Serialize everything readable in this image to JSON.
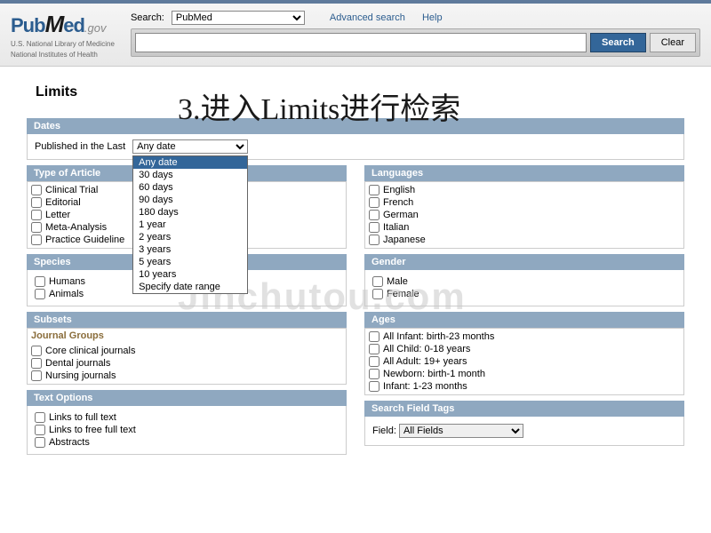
{
  "header": {
    "logo_text_pub": "Pub",
    "logo_text_m": "M",
    "logo_text_ed": "ed",
    "logo_gov": ".gov",
    "logo_sub1": "U.S. National Library of Medicine",
    "logo_sub2": "National Institutes of Health",
    "search_label": "Search:",
    "search_db_selected": "PubMed",
    "adv_search": "Advanced search",
    "help": "Help",
    "btn_search": "Search",
    "btn_clear": "Clear",
    "search_value": ""
  },
  "page_title": "Limits",
  "overlay": "3.进入Limits进行检索",
  "watermark": "Jinchutou.com",
  "dates": {
    "header": "Dates",
    "label": "Published in the Last",
    "selected": "Any date",
    "options": [
      "Any date",
      "30 days",
      "60 days",
      "90 days",
      "180 days",
      "1 year",
      "2 years",
      "3 years",
      "5 years",
      "10 years",
      "Specify date range"
    ]
  },
  "type_of_article": {
    "header": "Type of Article",
    "items": [
      "Clinical Trial",
      "Editorial",
      "Letter",
      "Meta-Analysis",
      "Practice Guideline"
    ]
  },
  "languages": {
    "header": "Languages",
    "items": [
      "English",
      "French",
      "German",
      "Italian",
      "Japanese"
    ]
  },
  "species": {
    "header": "Species",
    "items": [
      "Humans",
      "Animals"
    ]
  },
  "gender": {
    "header": "Gender",
    "items": [
      "Male",
      "Female"
    ]
  },
  "subsets": {
    "header": "Subsets",
    "subhead": "Journal Groups",
    "items": [
      "Core clinical journals",
      "Dental journals",
      "Nursing journals"
    ]
  },
  "ages": {
    "header": "Ages",
    "items": [
      "All Infant: birth-23 months",
      "All Child: 0-18 years",
      "All Adult: 19+ years",
      "Newborn: birth-1 month",
      "Infant: 1-23 months"
    ]
  },
  "text_options": {
    "header": "Text Options",
    "items": [
      "Links to full text",
      "Links to free full text",
      "Abstracts"
    ]
  },
  "search_field_tags": {
    "header": "Search Field Tags",
    "label": "Field:",
    "selected": "All Fields"
  }
}
